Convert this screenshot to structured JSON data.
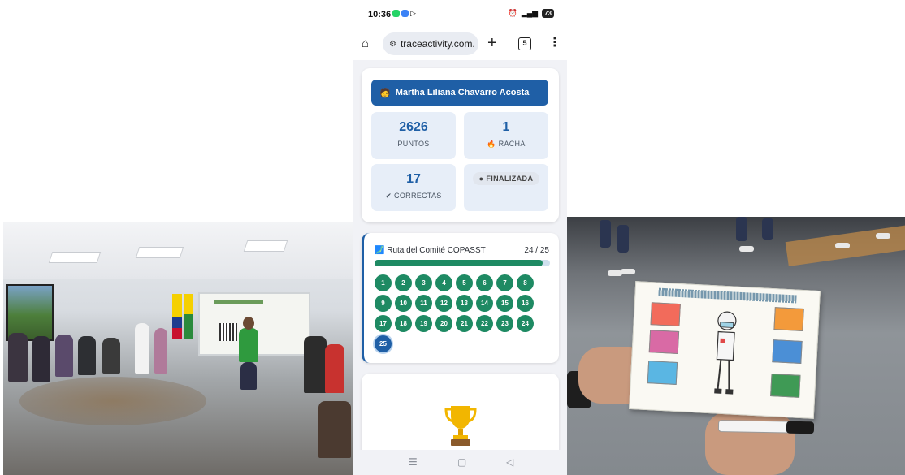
{
  "status_bar": {
    "time": "10:36",
    "battery": "73"
  },
  "browser": {
    "url": "traceactivity.com.",
    "tab_count": "5"
  },
  "profile": {
    "name": "Martha Liliana Chavarro Acosta",
    "user_icon": "person-emoji-icon"
  },
  "stats": {
    "points_value": "2626",
    "points_label": "PUNTOS",
    "streak_value": "1",
    "streak_label": "🔥 RACHA",
    "correct_value": "17",
    "correct_label": "✔ CORRECTAS",
    "status_badge": "● FINALIZADA"
  },
  "route": {
    "title": "🗾 Ruta del Comité COPASST",
    "progress_text": "24 / 25",
    "progress_fraction": 0.96,
    "steps": [
      "1",
      "2",
      "3",
      "4",
      "5",
      "6",
      "7",
      "8",
      "9",
      "10",
      "11",
      "12",
      "13",
      "14",
      "15",
      "16",
      "17",
      "18",
      "19",
      "20",
      "21",
      "22",
      "23",
      "24",
      "25"
    ],
    "current_step": "25"
  },
  "colors": {
    "primary_blue": "#1f5fa6",
    "completed_green": "#1e8a63",
    "card_bg": "#ffffff",
    "stat_bg": "#e7eef8"
  },
  "nav": {
    "recent": "☰",
    "home": "▢",
    "back": "◁"
  }
}
